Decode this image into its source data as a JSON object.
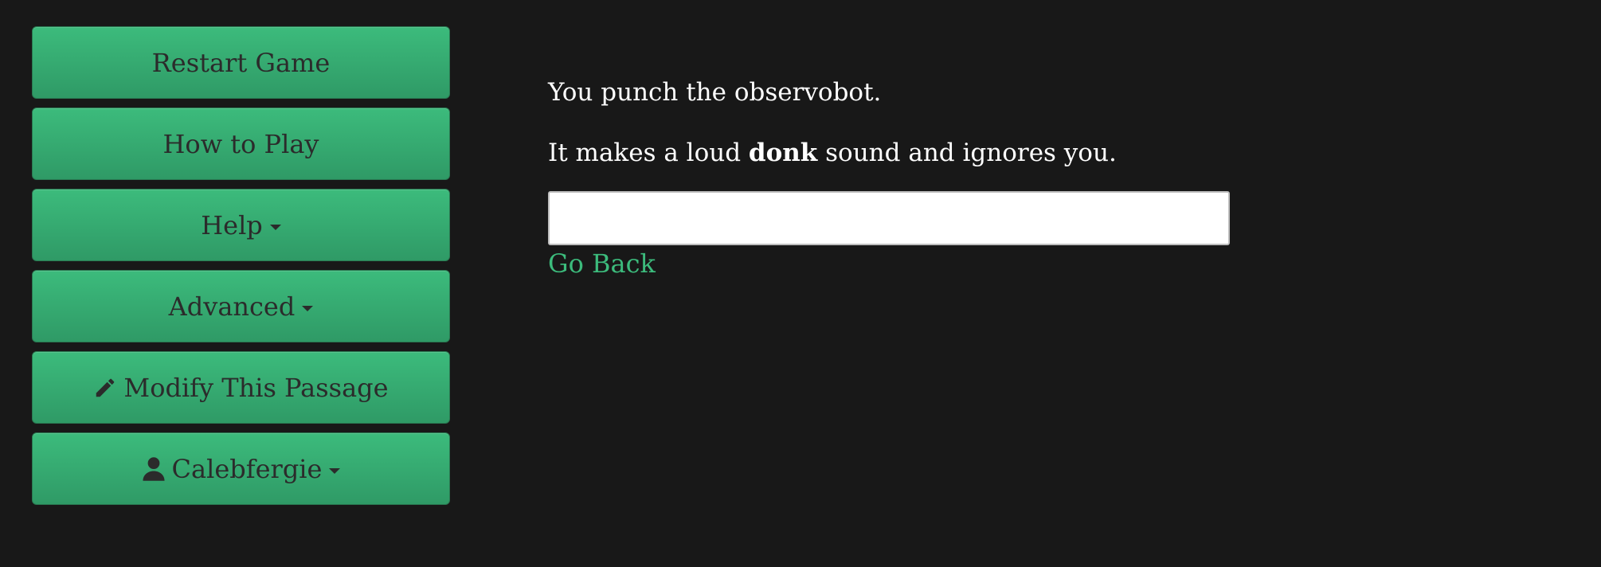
{
  "sidebar": {
    "buttons": [
      {
        "label": "Restart Game"
      },
      {
        "label": "How to Play"
      },
      {
        "label": "Help"
      },
      {
        "label": "Advanced"
      },
      {
        "label": "Modify This Passage",
        "icon": "pencil-icon"
      },
      {
        "label": "Calebfergie",
        "icon": "user-icon"
      }
    ]
  },
  "passage": {
    "line1": "You punch the observobot.",
    "line2_before": "It makes a loud ",
    "line2_bold": "donk",
    "line2_after": " sound and ignores you."
  },
  "command_input": {
    "value": ""
  },
  "go_back_label": "Go Back",
  "colors": {
    "background": "#181818",
    "button_green": "#3cbb7c",
    "link_green": "#3cbb7c",
    "text": "#ffffff"
  }
}
